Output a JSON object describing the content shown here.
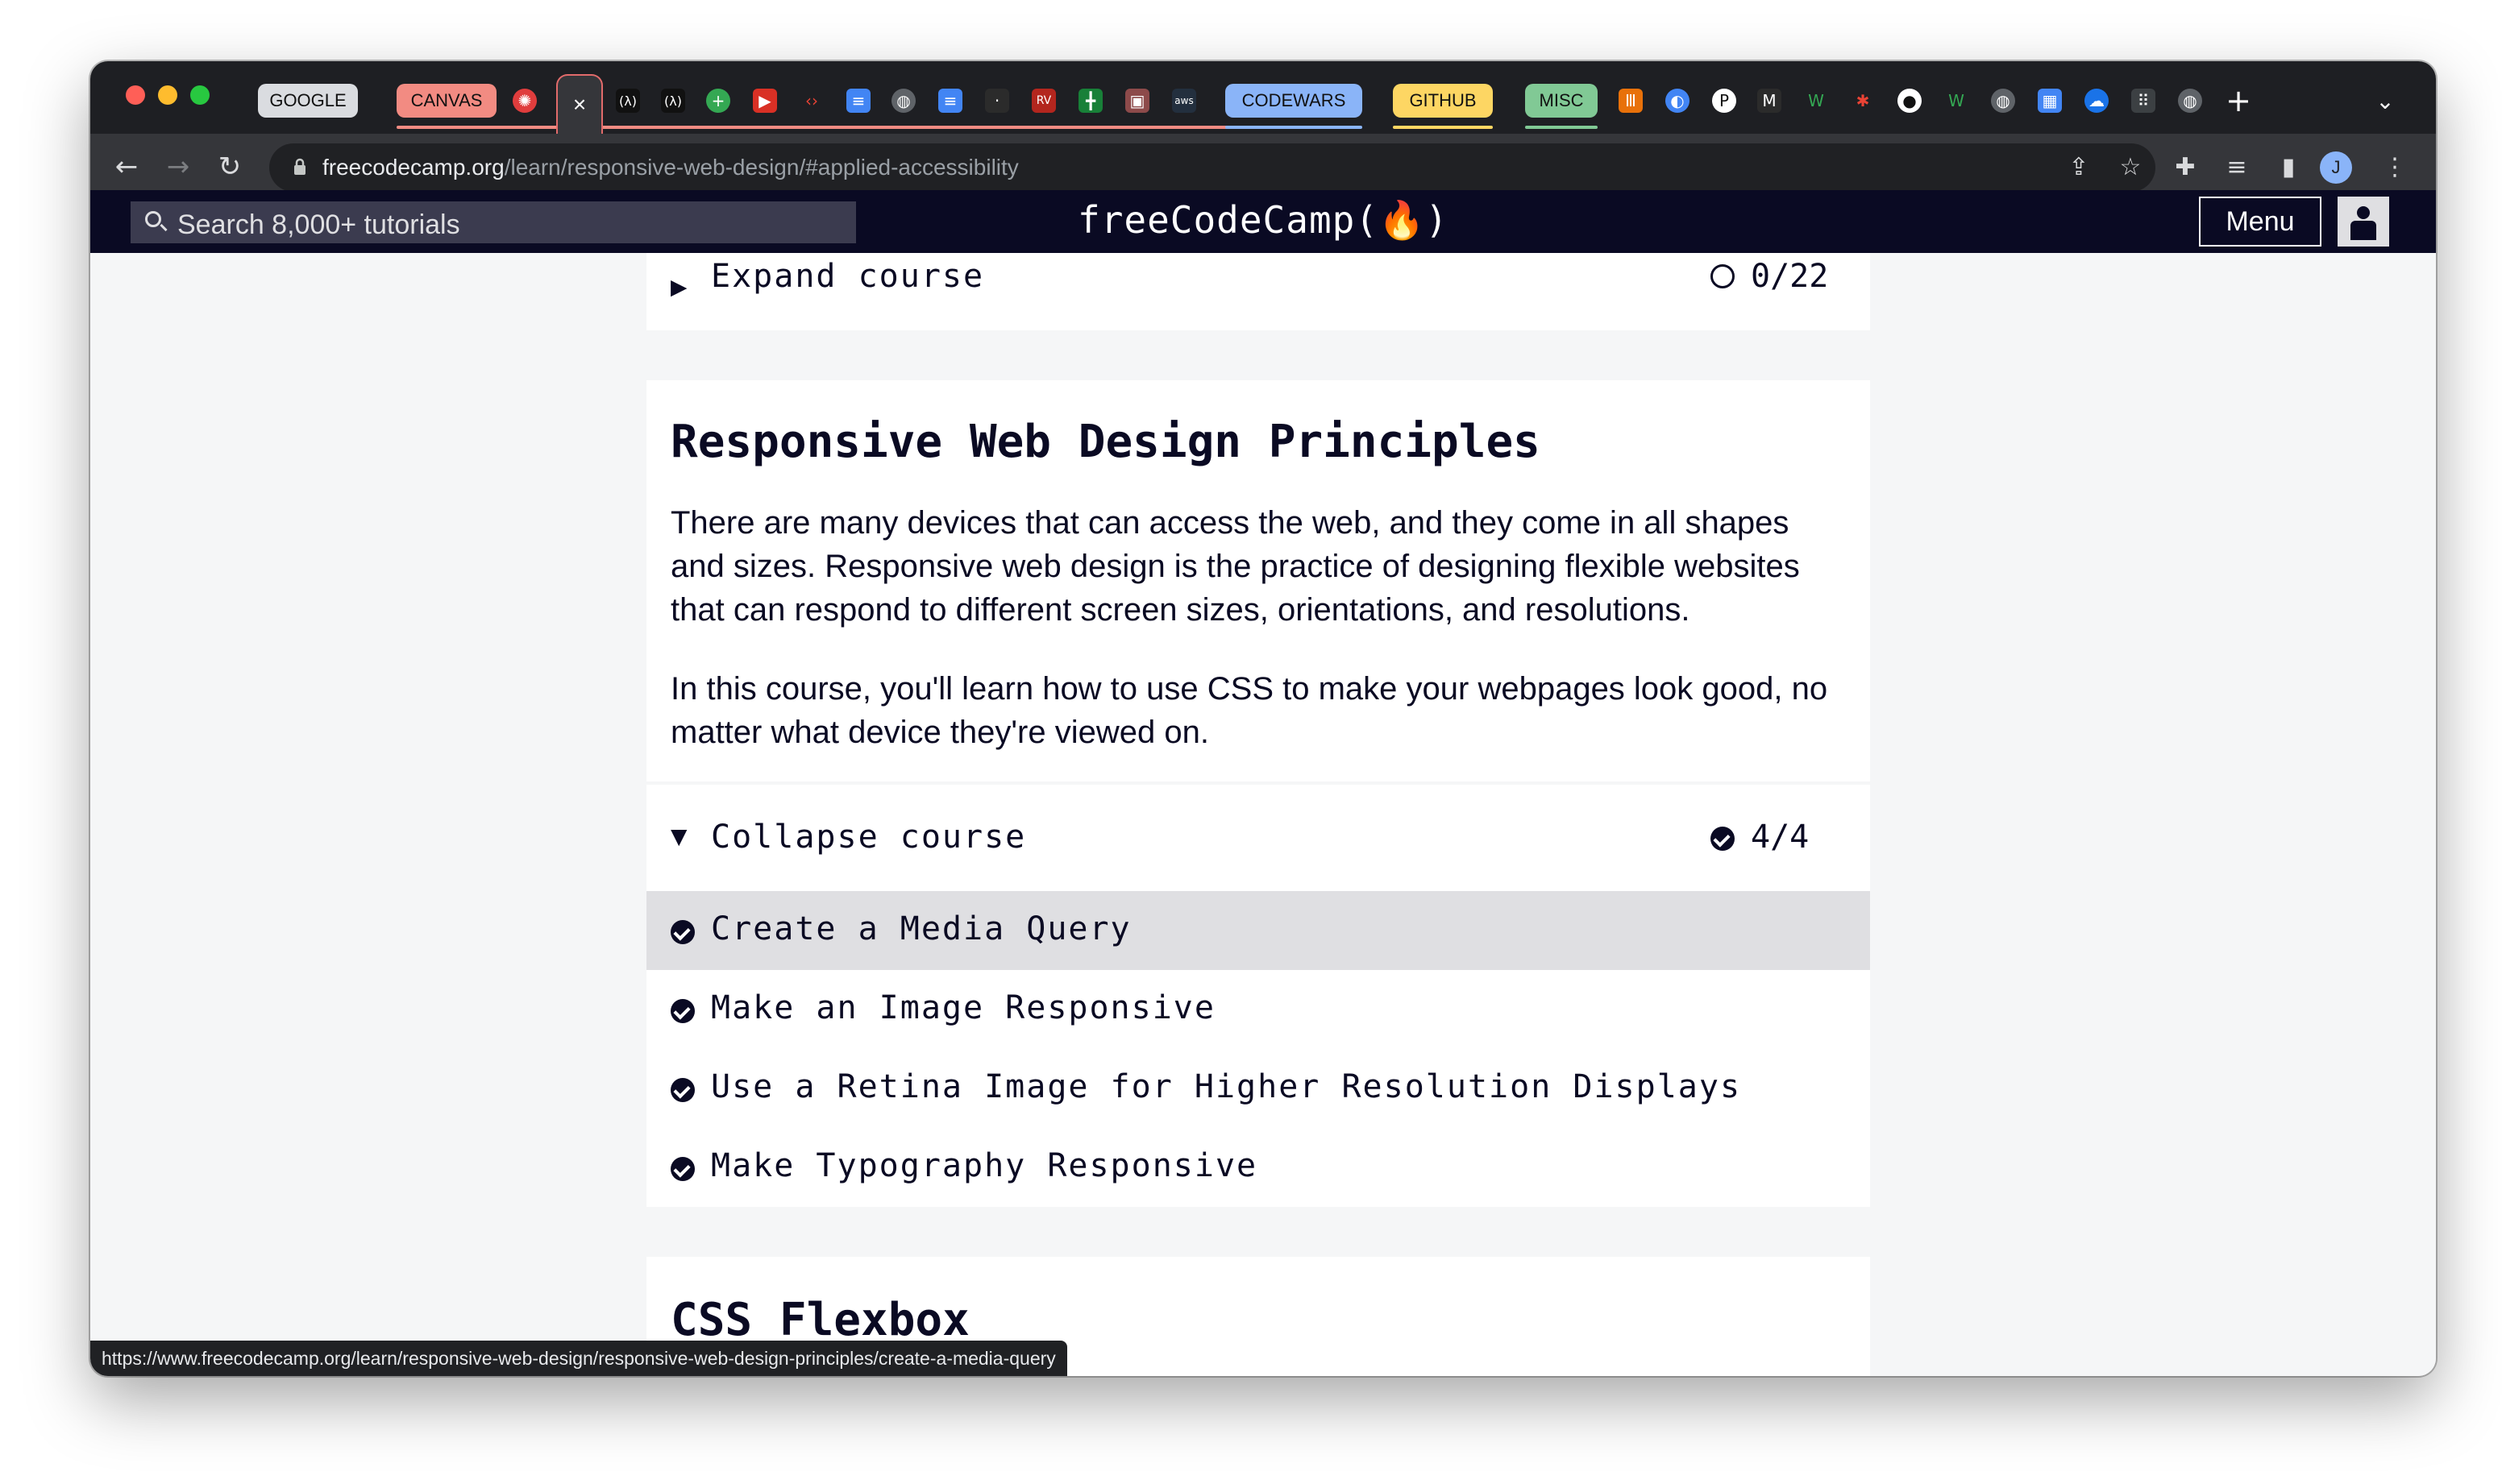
{
  "browser": {
    "tab_groups": {
      "google": "GOOGLE",
      "canvas": "CANVAS",
      "codewars": "CODEWARS",
      "github": "GITHUB",
      "misc": "MISC"
    },
    "active_tab_close": "×",
    "new_tab": "+",
    "tab_menu": "⌄",
    "url_host": "freecodecamp.org",
    "url_path": "/learn/responsive-web-design/#applied-accessibility",
    "profile_initial": "J",
    "status_url": "https://www.freecodecamp.org/learn/responsive-web-design/responsive-web-design-principles/create-a-media-query"
  },
  "site": {
    "search_placeholder": "Search 8,000+ tutorials",
    "brand": "freeCodeCamp(🔥)",
    "menu_label": "Menu"
  },
  "previous_block": {
    "expand_label": "Expand course",
    "progress": "0/22"
  },
  "block": {
    "title": "Responsive Web Design Principles",
    "intro_1": "There are many devices that can access the web, and they come in all shapes and sizes. Responsive web design is the practice of designing flexible websites that can respond to different screen sizes, orientations, and resolutions.",
    "intro_2": "In this course, you'll learn how to use CSS to make your webpages look good, no matter what device they're viewed on.",
    "collapse_label": "Collapse course",
    "progress": "4/4",
    "challenges": [
      "Create a Media Query",
      "Make an Image Responsive",
      "Use a Retina Image for Higher Resolution Displays",
      "Make Typography Responsive"
    ]
  },
  "next_block": {
    "title": "CSS Flexbox"
  },
  "colors": {
    "nav_bg": "#0a0a23",
    "hover_row": "#dfdfe2",
    "page_bg": "#f5f6f7"
  }
}
